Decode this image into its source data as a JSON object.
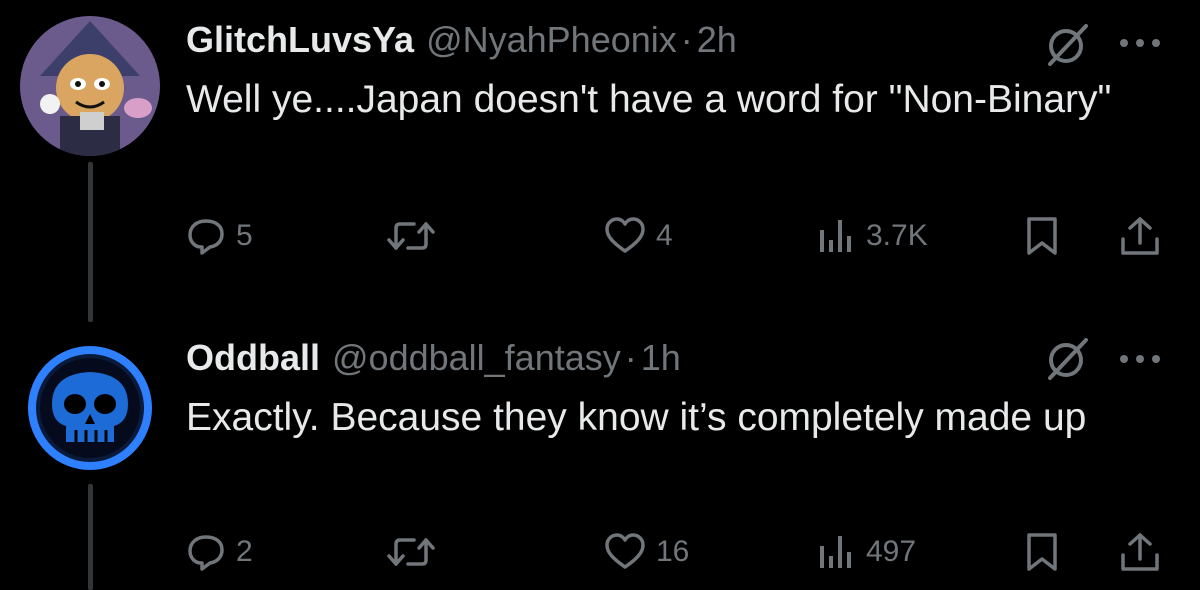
{
  "colors": {
    "background": "#000000",
    "primary_text": "#e7e9ea",
    "secondary_text": "#71767b",
    "thread_line": "#333639"
  },
  "tweets": [
    {
      "display_name": "GlitchLuvsYa",
      "handle": "@NyahPheonix",
      "separator": "·",
      "time": "2h",
      "text": "Well ye....Japan doesn't have a word for \"Non-Binary\"",
      "avatar_icon": "cartoon-character-avatar",
      "replies": "5",
      "retweets": "",
      "likes": "4",
      "views": "3.7K"
    },
    {
      "display_name": "Oddball",
      "handle": "@oddball_fantasy",
      "separator": "·",
      "time": "1h",
      "text": "Exactly. Because they know it’s completely made up",
      "avatar_icon": "blue-skull-avatar",
      "replies": "2",
      "retweets": "",
      "likes": "16",
      "views": "497"
    }
  ]
}
